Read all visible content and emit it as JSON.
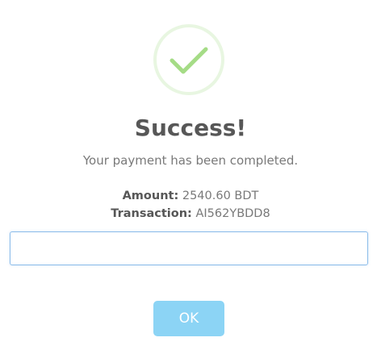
{
  "dialog": {
    "title": "Success!",
    "message": "Your payment has been completed.",
    "amount_label": "Amount:",
    "amount_value": "2540.60 BDT",
    "transaction_label": "Transaction:",
    "transaction_value": "AI562YBDD8",
    "input": {
      "value": "",
      "placeholder": ""
    },
    "ok_label": "OK",
    "icon": "success-check-icon"
  },
  "colors": {
    "check": "#a5dc86",
    "button": "#8cd4f5",
    "title": "#575757",
    "text": "#797979"
  }
}
